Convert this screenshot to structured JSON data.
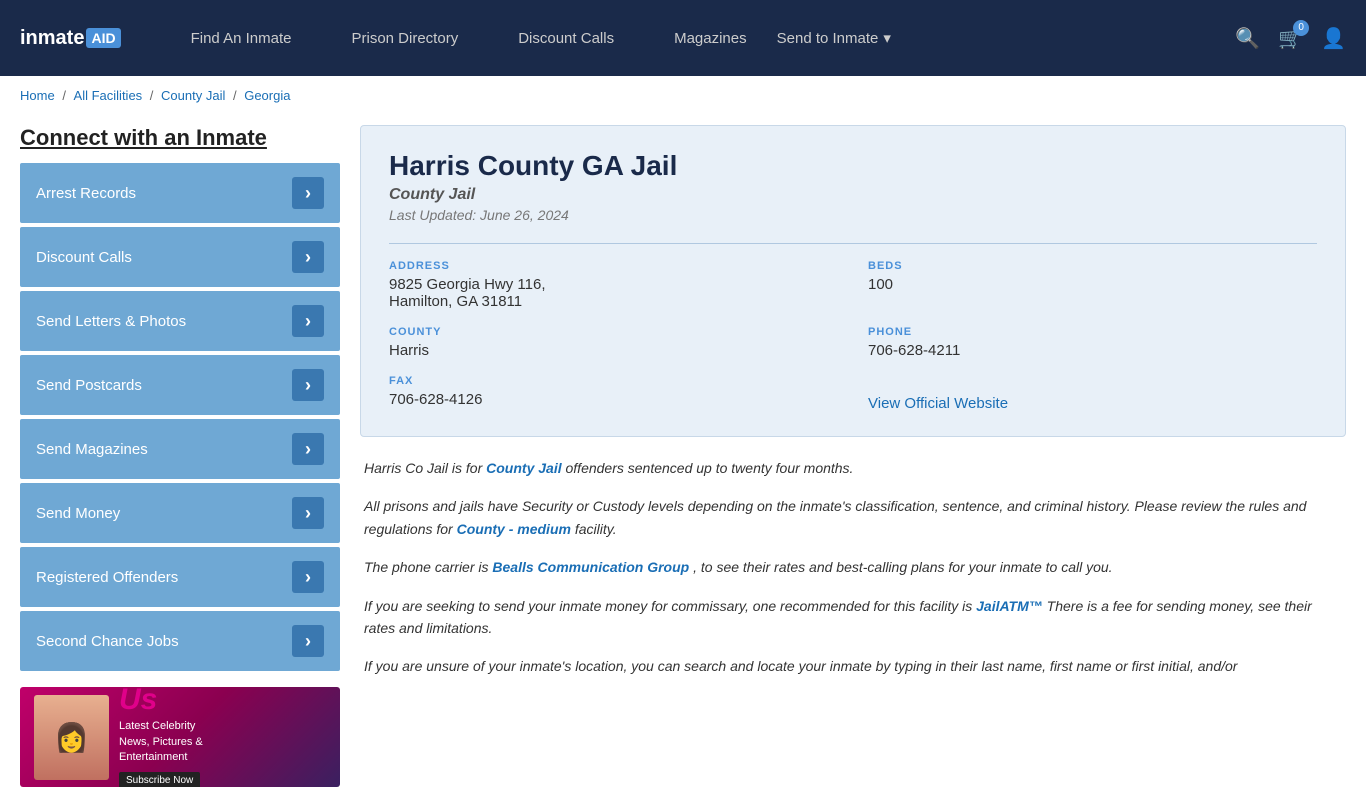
{
  "header": {
    "logo": "inmate",
    "logo_suffix": "AID",
    "nav_items": [
      {
        "label": "Find An Inmate",
        "id": "find-inmate"
      },
      {
        "label": "Prison Directory",
        "id": "prison-directory"
      },
      {
        "label": "Discount Calls",
        "id": "discount-calls"
      },
      {
        "label": "Magazines",
        "id": "magazines"
      },
      {
        "label": "Send to Inmate",
        "id": "send-to-inmate"
      }
    ],
    "cart_count": "0",
    "send_dropdown": "▾"
  },
  "breadcrumb": {
    "items": [
      "Home",
      "All Facilities",
      "County Jail",
      "Georgia"
    ]
  },
  "sidebar": {
    "title": "Connect with an Inmate",
    "menu": [
      {
        "label": "Arrest Records"
      },
      {
        "label": "Discount Calls"
      },
      {
        "label": "Send Letters & Photos"
      },
      {
        "label": "Send Postcards"
      },
      {
        "label": "Send Magazines"
      },
      {
        "label": "Send Money"
      },
      {
        "label": "Registered Offenders"
      },
      {
        "label": "Second Chance Jobs"
      }
    ],
    "ad": {
      "logo": "Us",
      "tagline": "Latest Celebrity\nNews, Pictures &\nEntertainment",
      "btn": "Subscribe Now"
    }
  },
  "facility": {
    "name": "Harris County GA Jail",
    "type": "County Jail",
    "last_updated": "Last Updated: June 26, 2024",
    "address_label": "ADDRESS",
    "address": "9825 Georgia Hwy 116,\nHamilton, GA 31811",
    "beds_label": "BEDS",
    "beds": "100",
    "county_label": "COUNTY",
    "county": "Harris",
    "phone_label": "PHONE",
    "phone": "706-628-4211",
    "fax_label": "FAX",
    "fax": "706-628-4126",
    "website_label": "View Official Website"
  },
  "description": {
    "para1_prefix": "Harris Co Jail is for ",
    "para1_link": "County Jail",
    "para1_suffix": " offenders sentenced up to twenty four months.",
    "para2": "All prisons and jails have Security or Custody levels depending on the inmate's classification, sentence, and criminal history. Please review the rules and regulations for ",
    "para2_link": "County - medium",
    "para2_suffix": " facility.",
    "para3_prefix": "The phone carrier is ",
    "para3_link": "Bealls Communication Group",
    "para3_suffix": ", to see their rates and best-calling plans for your inmate to call you.",
    "para4_prefix": "If you are seeking to send your inmate money for commissary, one recommended for this facility is ",
    "para4_link": "JailATM™",
    "para4_suffix": " There is a fee for sending money, see their rates and limitations.",
    "para5": "If you are unsure of your inmate's location, you can search and locate your inmate by typing in their last name, first name or first initial, and/or"
  }
}
